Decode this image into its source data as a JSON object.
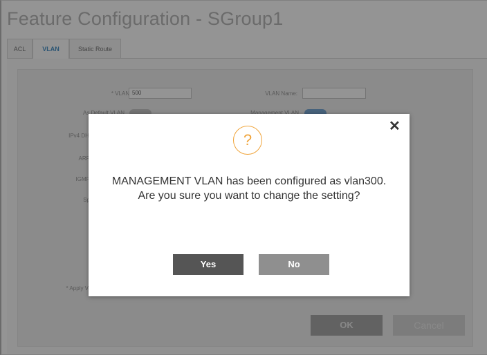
{
  "page": {
    "title": "Feature Configuration - SGroup1"
  },
  "tabs": [
    {
      "label": "ACL"
    },
    {
      "label": "VLAN"
    },
    {
      "label": "Static Route"
    }
  ],
  "form": {
    "vlan_id_label": "* VLAN #:",
    "vlan_id_value": "500",
    "vlan_name_label": "VLAN Name:",
    "vlan_name_value": "",
    "as_default_label": "As Default VLAN",
    "mgmt_vlan_label": "Management VLAN",
    "ipv4_dhcp_label": "IPv4 DHCP",
    "arp_label": "ARP",
    "igmp_label": "IGMP",
    "spanning_label": "Sp",
    "apply_label": "* Apply V"
  },
  "footer": {
    "ok_label": "OK",
    "cancel_label": "Cancel"
  },
  "dialog": {
    "icon": "question-mark-icon",
    "icon_glyph": "?",
    "close_glyph": "✕",
    "message": "MANAGEMENT VLAN has been configured as vlan300. Are you sure you want to change the setting?",
    "yes_label": "Yes",
    "no_label": "No"
  },
  "colors": {
    "active_tab": "#4a93c8",
    "warning_icon": "#f0a43a",
    "yes_button": "#555555",
    "no_button": "#8f8f8f"
  }
}
